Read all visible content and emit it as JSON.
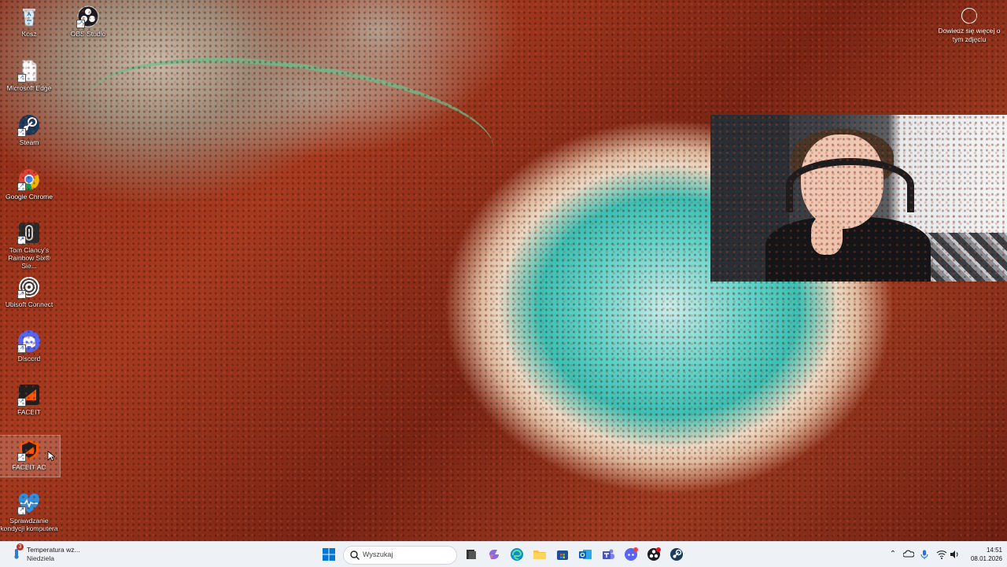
{
  "desktop": {
    "icons": [
      {
        "label": "Kosz",
        "icon": "recycle-bin-icon"
      },
      {
        "label": "OBS Studio",
        "icon": "obs-studio-icon"
      },
      {
        "label": "Microsoft Edge",
        "icon": "file-shortcut-icon"
      },
      {
        "label": "Steam",
        "icon": "steam-icon"
      },
      {
        "label": "Google Chrome",
        "icon": "chrome-icon"
      },
      {
        "label": "Tom Clancy's Rainbow Six® Sie...",
        "icon": "rainbow-six-icon"
      },
      {
        "label": "Ubisoft Connect",
        "icon": "ubisoft-connect-icon"
      },
      {
        "label": "Discord",
        "icon": "discord-icon"
      },
      {
        "label": "FACEIT",
        "icon": "faceit-icon"
      },
      {
        "label": "FACEIT AC",
        "icon": "faceit-ac-icon"
      },
      {
        "label": "Sprawdzanie kondycji komputera",
        "icon": "pc-health-check-icon"
      }
    ],
    "photo_info": "Dowiedz się więcej o tym zdjęciu"
  },
  "taskbar": {
    "weather": {
      "title": "Temperatura wz...",
      "subtitle": "Niedziela",
      "badge": "3"
    },
    "search_placeholder": "Wyszukaj",
    "pinned": [
      "start-icon",
      "search-icon",
      "task-view-icon",
      "copilot-icon",
      "edge-icon",
      "file-explorer-icon",
      "microsoft-store-icon",
      "outlook-icon",
      "teams-icon",
      "discord-icon",
      "obs-studio-icon",
      "steam-icon"
    ],
    "tray": [
      "chevron-up-icon",
      "onedrive-icon",
      "microphone-icon",
      "wifi-icon",
      "volume-icon"
    ],
    "time": "14:51",
    "date": "08.01.2026"
  },
  "colors": {
    "taskbar_bg": "#eef1f5",
    "accent": "#0078d4"
  }
}
